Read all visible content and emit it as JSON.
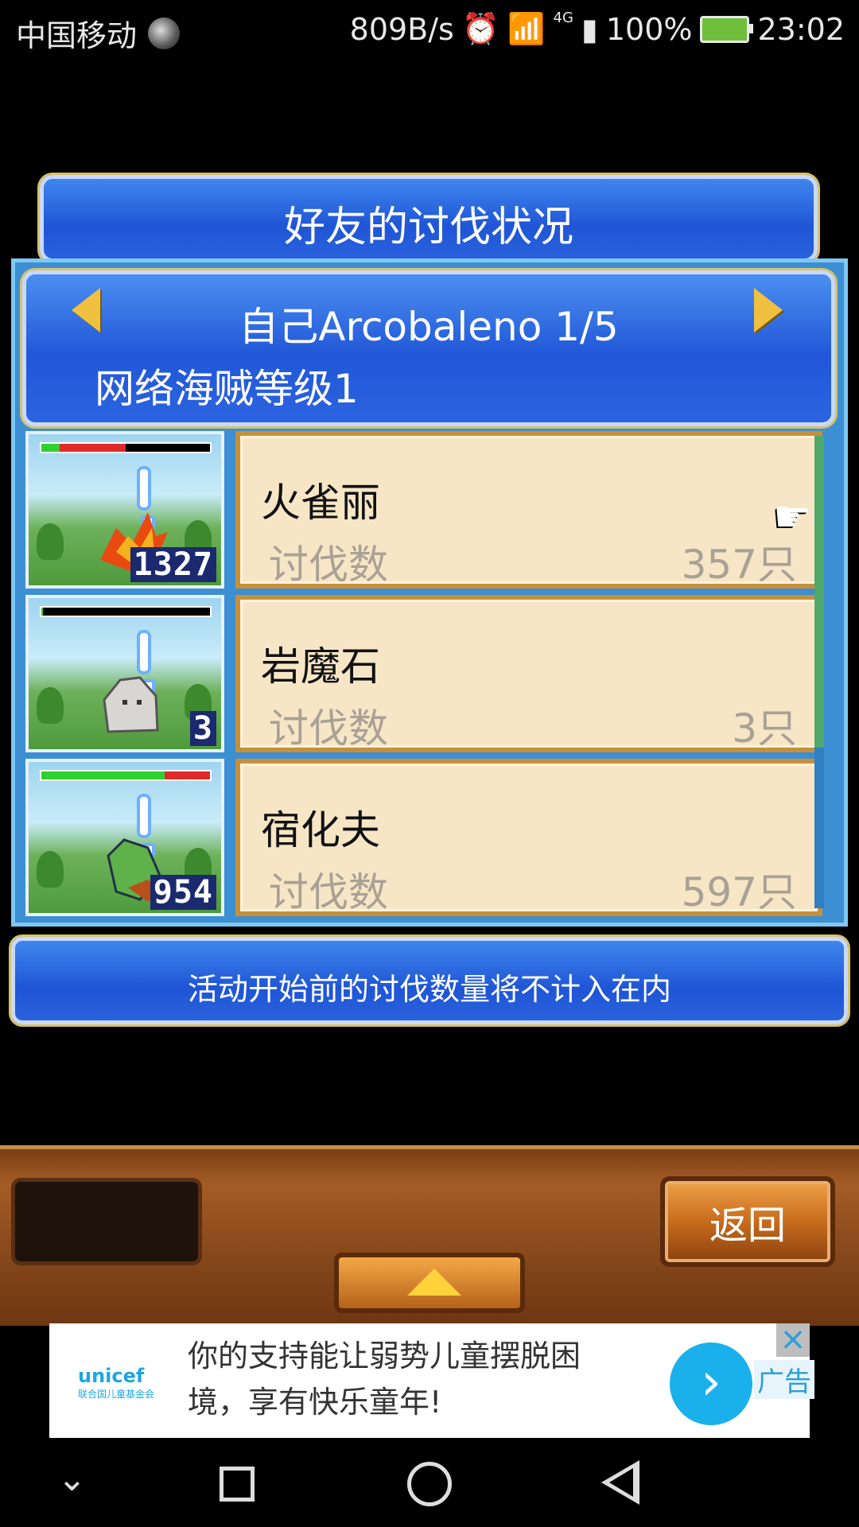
{
  "status_bar": {
    "carrier": "中国移动",
    "net_speed": "809B/s",
    "network_type": "4G",
    "battery": "100%",
    "time": "23:02"
  },
  "title": "好友的讨伐状况",
  "player": {
    "name": "自己Arcobaleno 1/5",
    "level": "网络海贼等级1"
  },
  "list": {
    "kill_label": "讨伐数",
    "items": [
      {
        "name": "火雀丽",
        "count": "357只",
        "level": "1327",
        "hp_green": 0.11,
        "hp_red": 0.39
      },
      {
        "name": "岩魔石",
        "count": "3只",
        "level": "3",
        "hp_green": 0.01,
        "hp_red": 0.0
      },
      {
        "name": "宿化夫",
        "count": "597只",
        "level": "954",
        "hp_green": 0.73,
        "hp_red": 0.27
      }
    ],
    "scroll_fraction": 0.66
  },
  "notice": "活动开始前的讨伐数量将不计入在内",
  "buttons": {
    "back": "返回"
  },
  "ad": {
    "brand": "unicef",
    "brand_sub": "联合国儿童基金会",
    "text": "你的支持能让弱势儿童摆脱困境，享有快乐童年!",
    "tag": "广告"
  }
}
